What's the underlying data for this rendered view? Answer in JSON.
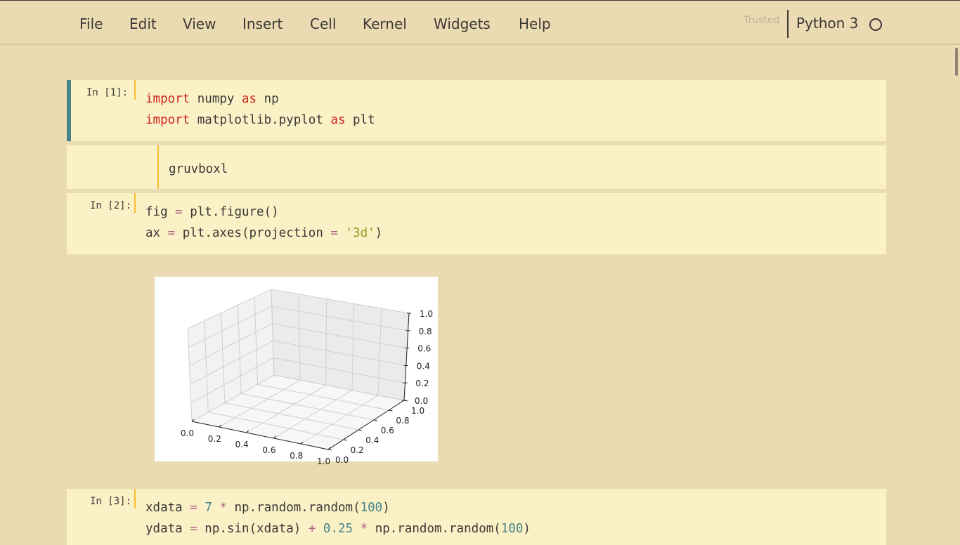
{
  "menubar": {
    "items": [
      "File",
      "Edit",
      "View",
      "Insert",
      "Cell",
      "Kernel",
      "Widgets",
      "Help"
    ],
    "trusted": "Trusted",
    "kernel": "Python 3",
    "kernel_status": "idle"
  },
  "cells": {
    "c1": {
      "prompt": "In [1]:",
      "lines": [
        [
          {
            "t": "import",
            "c": "kw"
          },
          {
            "t": " numpy "
          },
          {
            "t": "as",
            "c": "kw"
          },
          {
            "t": " np"
          }
        ],
        [
          {
            "t": "import",
            "c": "kw"
          },
          {
            "t": " matplotlib.pyplot "
          },
          {
            "t": "as",
            "c": "kw"
          },
          {
            "t": " plt"
          }
        ]
      ]
    },
    "c_md": {
      "text": "gruvboxl"
    },
    "c2": {
      "prompt": "In [2]:",
      "lines": [
        [
          {
            "t": "fig "
          },
          {
            "t": "=",
            "c": "op"
          },
          {
            "t": " plt.figure()"
          }
        ],
        [
          {
            "t": "ax "
          },
          {
            "t": "=",
            "c": "op"
          },
          {
            "t": " plt.axes(projection "
          },
          {
            "t": "=",
            "c": "op"
          },
          {
            "t": " "
          },
          {
            "t": "'3d'",
            "c": "str"
          },
          {
            "t": ")"
          }
        ]
      ]
    },
    "c3": {
      "prompt": "In [3]:",
      "lines": [
        [
          {
            "t": "xdata "
          },
          {
            "t": "=",
            "c": "op"
          },
          {
            "t": " "
          },
          {
            "t": "7",
            "c": "num"
          },
          {
            "t": " "
          },
          {
            "t": "*",
            "c": "op"
          },
          {
            "t": " np.random.random("
          },
          {
            "t": "100",
            "c": "num"
          },
          {
            "t": ")"
          }
        ],
        [
          {
            "t": "ydata "
          },
          {
            "t": "=",
            "c": "op"
          },
          {
            "t": " np.sin(xdata) "
          },
          {
            "t": "+",
            "c": "op"
          },
          {
            "t": " "
          },
          {
            "t": "0.25",
            "c": "num"
          },
          {
            "t": " "
          },
          {
            "t": "*",
            "c": "op"
          },
          {
            "t": " np.random.random("
          },
          {
            "t": "100",
            "c": "num"
          },
          {
            "t": ")"
          }
        ]
      ]
    }
  },
  "output_plot": {
    "x_ticks": [
      "0.0",
      "0.2",
      "0.4",
      "0.6",
      "0.8",
      "1.0"
    ],
    "y_ticks": [
      "0.0",
      "0.2",
      "0.4",
      "0.6",
      "0.8",
      "1.0"
    ],
    "z_ticks": [
      "0.0",
      "0.2",
      "0.4",
      "0.6",
      "0.8",
      "1.0"
    ]
  },
  "colors": {
    "background": "#ebdbb2",
    "cell_bg": "#fbf1c7",
    "selected_border": "#458588",
    "keyword": "#cc241d",
    "operator": "#b16286",
    "number": "#458588",
    "string": "#98971a"
  }
}
